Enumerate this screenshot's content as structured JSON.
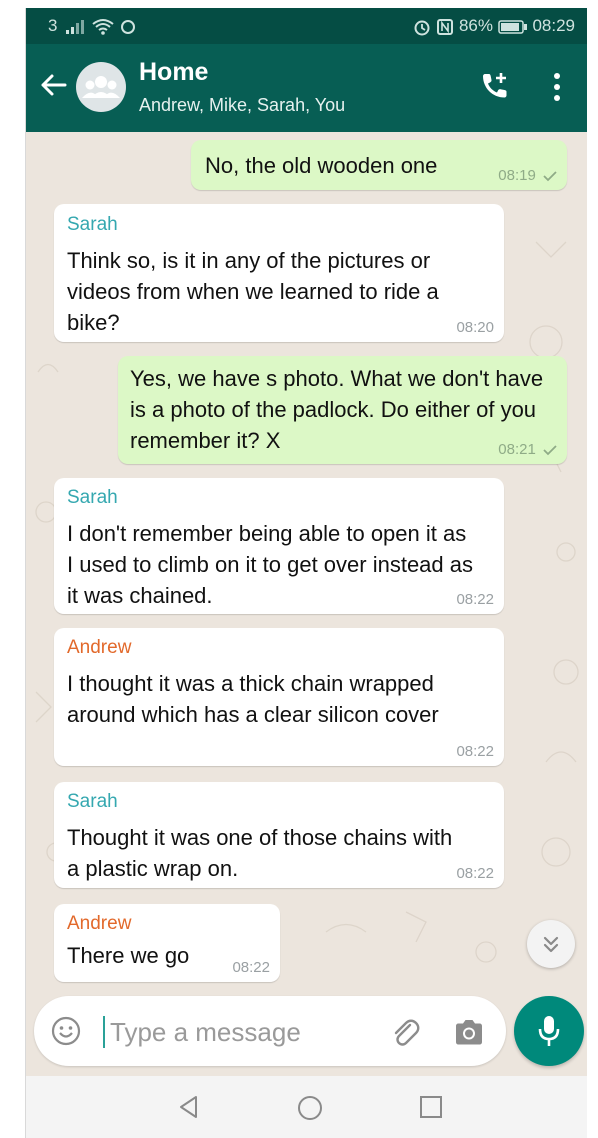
{
  "status_bar": {
    "left": "3",
    "right": "86%",
    "time": "08:29"
  },
  "header": {
    "title": "Home",
    "subtitle": "Andrew, Mike, Sarah, You"
  },
  "colors": {
    "header": "#075e54",
    "outgoing_bubble": "#dcf8c6",
    "incoming_bubble": "#ffffff",
    "sender_sarah": "#35a8b0",
    "sender_andrew": "#e2692b",
    "accent": "#00897b"
  },
  "icons": [
    "back-arrow-icon",
    "group-avatar-icon",
    "add-call-icon",
    "more-vert-icon",
    "emoji-icon",
    "attach-icon",
    "camera-icon",
    "mic-icon",
    "double-chevron-down-icon",
    "nav-back-icon",
    "nav-home-icon",
    "nav-recent-icon"
  ],
  "messages": [
    {
      "direction": "out",
      "text": "No, the old wooden one",
      "time": "08:19"
    },
    {
      "direction": "in",
      "sender": "Sarah",
      "text": "Think so, is it in any of the pictures or videos from when we learned to ride a bike?",
      "time": "08:20"
    },
    {
      "direction": "out",
      "text": "Yes, we have s photo. What we don't have is a photo of the padlock. Do either of you remember it? X",
      "time": "08:21"
    },
    {
      "direction": "in",
      "sender": "Sarah",
      "text": "I don't remember being able to open it as I used to climb on it to get over instead as it was chained.",
      "time": "08:22"
    },
    {
      "direction": "in",
      "sender": "Andrew",
      "text": "I thought it was a thick chain wrapped around which has a clear silicon cover",
      "time": "08:22"
    },
    {
      "direction": "in",
      "sender": "Sarah",
      "text": "Thought it was one of those chains with a plastic wrap on.",
      "time": "08:22"
    },
    {
      "direction": "in",
      "sender": "Andrew",
      "text": "There we go",
      "time": "08:22"
    }
  ],
  "input": {
    "placeholder": "Type a message",
    "value": ""
  }
}
